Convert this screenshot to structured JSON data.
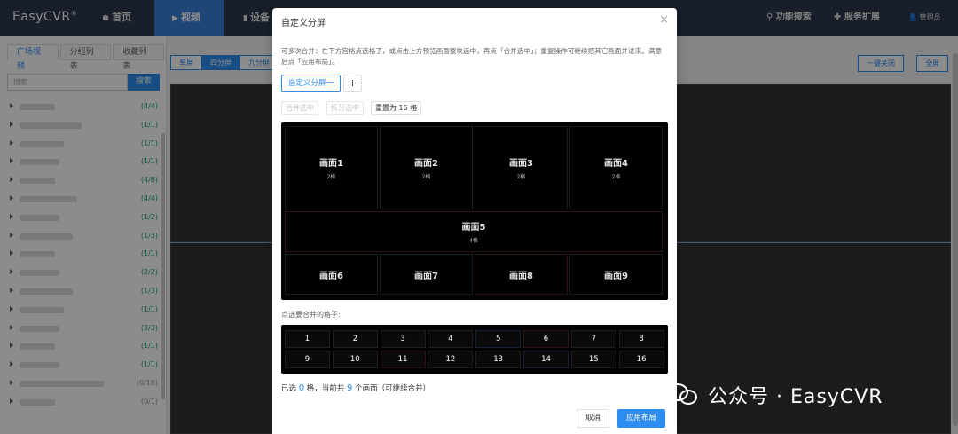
{
  "app": {
    "logo": "EasyCVR",
    "logo_mark": "®"
  },
  "nav": {
    "home": "首页",
    "video": "视频",
    "device": "设备",
    "feature_search": "功能搜索",
    "service_ext": "服务扩展",
    "user": "管理员"
  },
  "sidebar": {
    "tabs": [
      "广场视频",
      "分组列表",
      "收藏列表"
    ],
    "search_placeholder": "搜索",
    "search_button": "搜索",
    "counts": [
      "(4/4)",
      "(1/1)",
      "(1/1)",
      "(1/1)",
      "(4/8)",
      "(4/4)",
      "(1/2)",
      "(1/3)",
      "(1/1)",
      "(2/2)",
      "(1/3)",
      "(1/1)",
      "(3/3)",
      "(1/1)",
      "(1/1)",
      "(0/18)",
      "(0/1)"
    ]
  },
  "layout_tabs": [
    "单屏",
    "四分屏",
    "九分屏"
  ],
  "main_buttons": {
    "close_all": "一键关闭",
    "fullscreen": "全屏"
  },
  "dialog": {
    "title": "自定义分屏",
    "close": "×",
    "hint": "可多次合并：在下方宫格点选格子，或点击上方预览画面整块选中，再点「合并选中」；重复操作可继续把其它画面并进来。满意后点「应用布局」。",
    "layout_tag": "自定义分屏一",
    "plus": "+",
    "merge_selected": "合并选中",
    "split_selected": "拆分选中",
    "reset": "重置为 16 格",
    "panes": [
      {
        "name": "画面1",
        "sub": "2格"
      },
      {
        "name": "画面2",
        "sub": "2格"
      },
      {
        "name": "画面3",
        "sub": "2格"
      },
      {
        "name": "画面4",
        "sub": "2格"
      },
      {
        "name": "画面5",
        "sub": "4格"
      },
      {
        "name": "画面6",
        "sub": ""
      },
      {
        "name": "画面7",
        "sub": ""
      },
      {
        "name": "画面8",
        "sub": ""
      },
      {
        "name": "画面9",
        "sub": ""
      }
    ],
    "select_hint": "点选要合并的格子:",
    "grid": [
      "1",
      "2",
      "3",
      "4",
      "5",
      "6",
      "7",
      "8",
      "9",
      "10",
      "11",
      "12",
      "13",
      "14",
      "15",
      "16"
    ],
    "status": {
      "pre": "已选",
      "selected": "0",
      "mid": "格，当前共",
      "total": "9",
      "post": "个画面（可继续合并）"
    },
    "cancel": "取消",
    "apply": "应用布局"
  },
  "watermark": "公众号 · EasyCVR",
  "colors": {
    "primary": "#2d8cf0",
    "topbar": "#2d3a4e",
    "count_green": "#19a15f"
  }
}
